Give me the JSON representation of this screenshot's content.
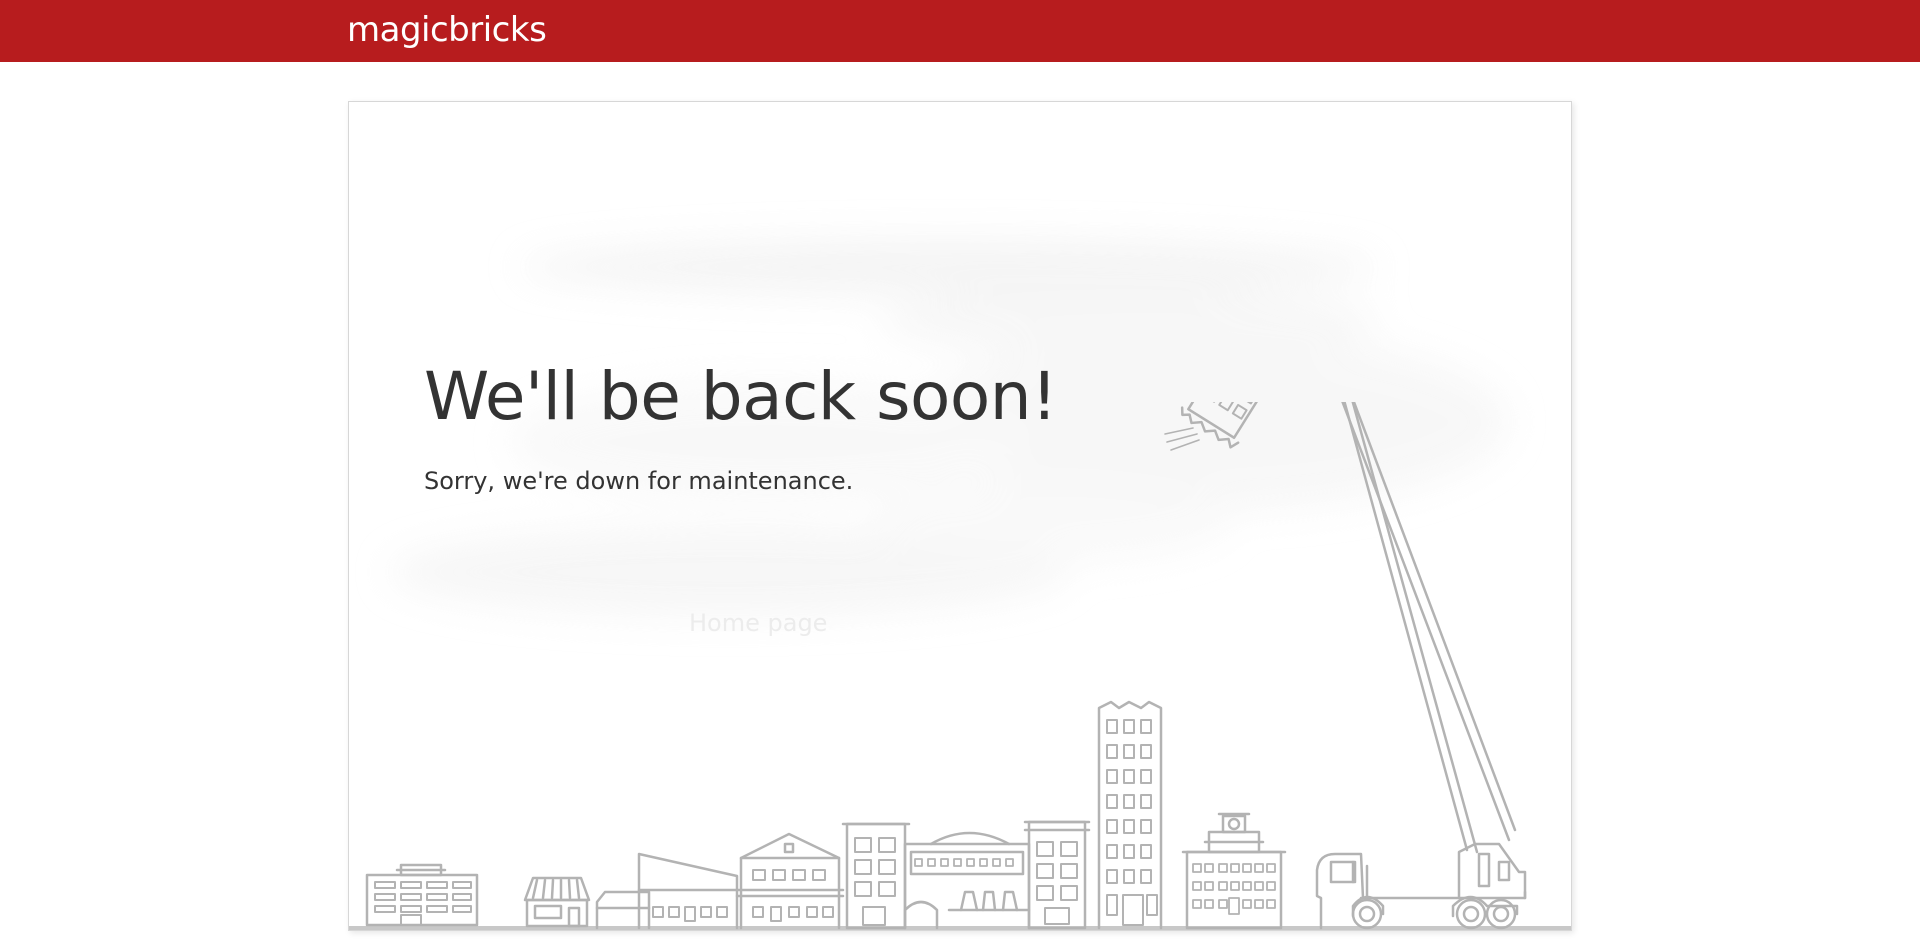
{
  "header": {
    "logo_text": "magicbricks",
    "bg_color": "#b71c1e"
  },
  "main": {
    "headline": "We'll be back soon!",
    "subline": "Sorry, we're down for maintenance.",
    "home_link": "Home page"
  },
  "illustration": {
    "line_color": "#b3b3b3",
    "icon": "city-skyline-crane-illustration"
  }
}
